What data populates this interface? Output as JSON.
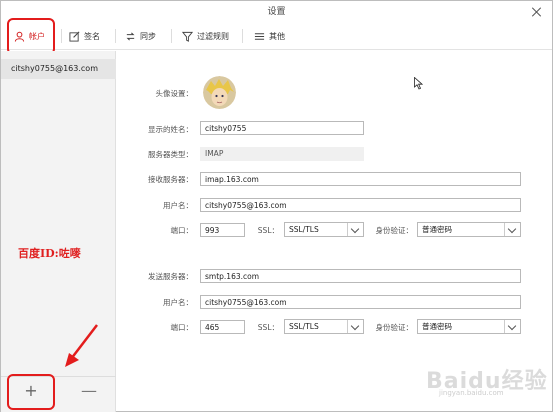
{
  "window": {
    "title": "设置"
  },
  "toolbar": {
    "tabs": [
      {
        "label": "帐户"
      },
      {
        "label": "签名"
      },
      {
        "label": "同步"
      },
      {
        "label": "过滤规则"
      },
      {
        "label": "其他"
      }
    ]
  },
  "sidebar": {
    "accounts": [
      "citshy0755@163.com"
    ],
    "add_label": "+",
    "remove_label": "—"
  },
  "annotation": {
    "text": "百度ID:咗嘜"
  },
  "form": {
    "avatar_label": "头像设置：",
    "display_name_label": "显示的姓名：",
    "display_name": "citshy0755",
    "server_type_label": "服务器类型：",
    "server_type": "IMAP",
    "incoming": {
      "server_label": "接收服务器：",
      "server": "imap.163.com",
      "username_label": "用户名：",
      "username": "citshy0755@163.com",
      "port_label": "端口：",
      "port": "993",
      "ssl_label": "SSL：",
      "ssl": "SSL/TLS",
      "auth_label": "身份验证：",
      "auth": "普通密码"
    },
    "outgoing": {
      "server_label": "发送服务器：",
      "server": "smtp.163.com",
      "username_label": "用户名：",
      "username": "citshy0755@163.com",
      "port_label": "端口：",
      "port": "465",
      "ssl_label": "SSL：",
      "ssl": "SSL/TLS",
      "auth_label": "身份验证：",
      "auth": "普通密码"
    }
  },
  "watermark": {
    "brand": "Baidu经验",
    "url": "jingyan.baidu.com"
  },
  "colors": {
    "highlight_red": "#e31c1c"
  }
}
